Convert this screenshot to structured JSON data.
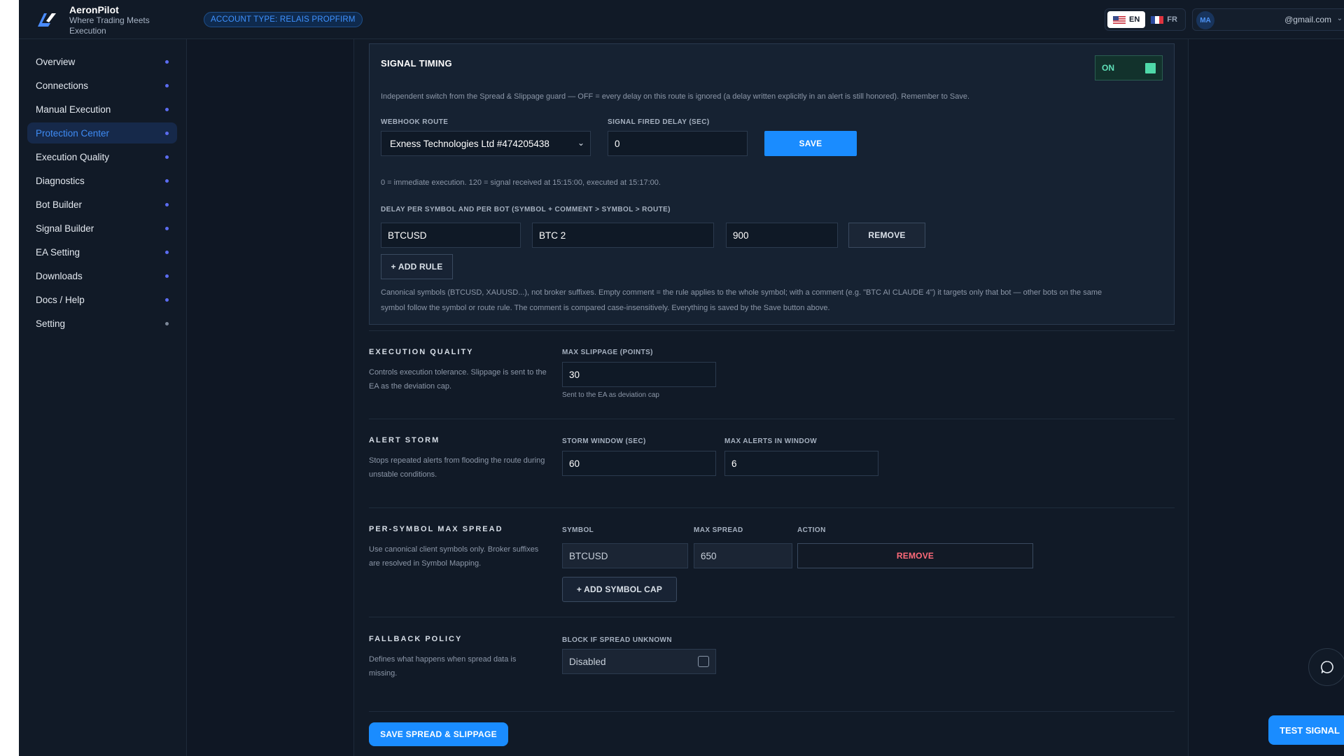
{
  "brand": {
    "name": "AeronPilot",
    "tagline": "Where Trading Meets Execution"
  },
  "header": {
    "account_badge": "ACCOUNT TYPE: RELAIS PROPFIRM",
    "languages": [
      {
        "code": "EN",
        "active": true
      },
      {
        "code": "FR",
        "active": false
      }
    ],
    "user_initials": "MA",
    "user_email": "@gmail.com"
  },
  "sidebar": {
    "items": [
      {
        "label": "Overview",
        "active": false
      },
      {
        "label": "Connections",
        "active": false
      },
      {
        "label": "Manual Execution",
        "active": false
      },
      {
        "label": "Protection Center",
        "active": true
      },
      {
        "label": "Execution Quality",
        "active": false
      },
      {
        "label": "Diagnostics",
        "active": false
      },
      {
        "label": "Bot Builder",
        "active": false
      },
      {
        "label": "Signal Builder",
        "active": false
      },
      {
        "label": "EA Setting",
        "active": false
      },
      {
        "label": "Downloads",
        "active": false
      },
      {
        "label": "Docs / Help",
        "active": false
      },
      {
        "label": "Setting",
        "active": false
      }
    ]
  },
  "signal_timing": {
    "title": "SIGNAL TIMING",
    "toggle_label": "ON",
    "description": "Independent switch from the Spread & Slippage guard — OFF = every delay on this route is ignored (a delay written explicitly in an alert is still honored). Remember to Save.",
    "webhook_route_label": "WEBHOOK ROUTE",
    "webhook_route_value": "Exness Technologies Ltd #474205438",
    "fired_delay_label": "SIGNAL FIRED DELAY (SEC)",
    "fired_delay_value": "0",
    "save_label": "SAVE",
    "hint": "0 = immediate execution. 120 = signal received at 15:15:00, executed at 15:17:00.",
    "per_symbol_label": "DELAY PER SYMBOL AND PER BOT (SYMBOL + COMMENT > SYMBOL > ROUTE)",
    "rule": {
      "symbol": "BTCUSD",
      "comment": "BTC 2",
      "delay": "900",
      "remove_label": "REMOVE"
    },
    "add_rule_label": "+ ADD RULE",
    "footnote_line1": "Canonical symbols (BTCUSD, XAUUSD...), not broker suffixes. Empty comment = the rule applies to the whole symbol; with a comment (e.g. \"BTC AI CLAUDE 4\") it targets only that bot — other bots on the same",
    "footnote_line2": "symbol follow the symbol or route rule. The comment is compared case-insensitively. Everything is saved by the Save button above."
  },
  "execution_quality": {
    "title": "EXECUTION QUALITY",
    "description": "Controls execution tolerance. Slippage is sent to the EA as the deviation cap.",
    "max_slippage_label": "MAX SLIPPAGE (POINTS)",
    "max_slippage_value": "30",
    "max_slippage_hint": "Sent to the EA as deviation cap"
  },
  "alert_storm": {
    "title": "ALERT STORM",
    "description": "Stops repeated alerts from flooding the route during unstable conditions.",
    "window_label": "STORM WINDOW (SEC)",
    "window_value": "60",
    "max_alerts_label": "MAX ALERTS IN WINDOW",
    "max_alerts_value": "6"
  },
  "per_symbol_spread": {
    "title": "PER-SYMBOL MAX SPREAD",
    "description": "Use canonical client symbols only. Broker suffixes are resolved in Symbol Mapping.",
    "col_symbol": "SYMBOL",
    "col_max_spread": "MAX SPREAD",
    "col_action": "ACTION",
    "row": {
      "symbol": "BTCUSD",
      "max_spread": "650",
      "remove_label": "REMOVE"
    },
    "add_label": "+ ADD SYMBOL CAP"
  },
  "fallback_policy": {
    "title": "FALLBACK POLICY",
    "description": "Defines what happens when spread data is missing.",
    "block_label": "BLOCK IF SPREAD UNKNOWN",
    "block_value": "Disabled",
    "checked": false
  },
  "save_spread_label": "SAVE SPREAD & SLIPPAGE",
  "test_signal_label": "TEST SIGNAL",
  "colors": {
    "accent": "#1a8cff",
    "toggle_on": "#4fd9a9",
    "danger": "#ff6b7a",
    "background": "#0f1724",
    "panel": "#111a27"
  }
}
